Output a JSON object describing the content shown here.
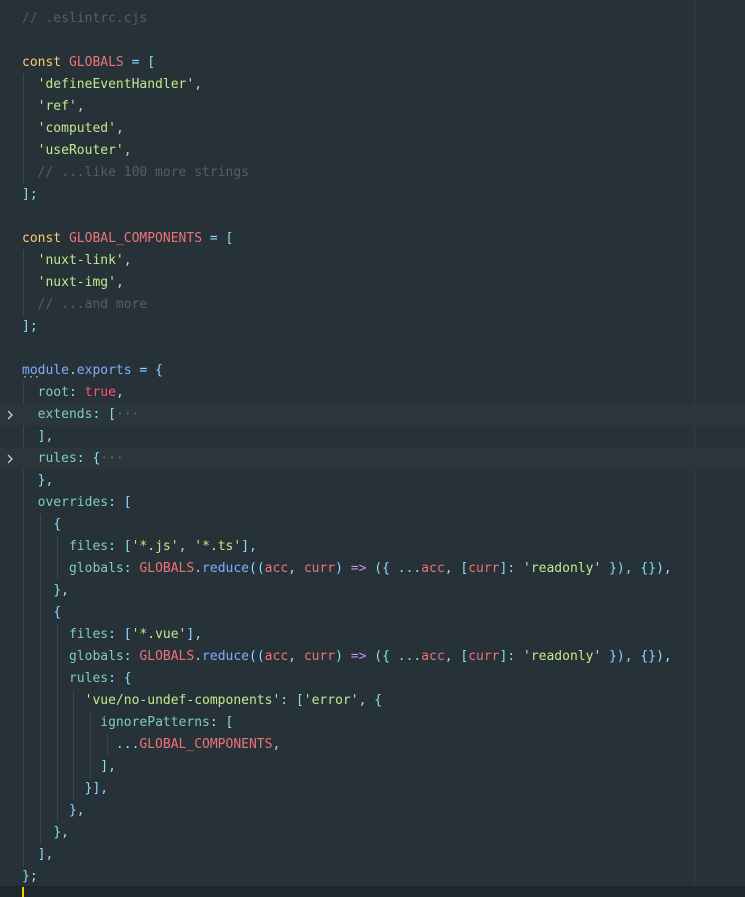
{
  "editor": {
    "file_comment": "// .eslintrc.cjs",
    "colors": {
      "background": "#263238",
      "folded_line": "#2b363b",
      "cursor": "#ffcc00"
    },
    "icons": {
      "fold_chevron": "chevron-right-icon"
    }
  },
  "lines": [
    {
      "tokens": [
        {
          "c": "comment",
          "t": "// .eslintrc.cjs"
        }
      ]
    },
    {
      "tokens": []
    },
    {
      "tokens": [
        {
          "c": "const",
          "t": "const "
        },
        {
          "c": "var",
          "t": "GLOBALS"
        },
        {
          "c": "punc",
          "t": " = ["
        }
      ]
    },
    {
      "tokens": [
        {
          "c": "plain",
          "t": "  "
        },
        {
          "c": "string",
          "t": "'defineEventHandler'"
        },
        {
          "c": "plain",
          "t": ","
        }
      ]
    },
    {
      "tokens": [
        {
          "c": "plain",
          "t": "  "
        },
        {
          "c": "string",
          "t": "'ref'"
        },
        {
          "c": "plain",
          "t": ","
        }
      ]
    },
    {
      "tokens": [
        {
          "c": "plain",
          "t": "  "
        },
        {
          "c": "string",
          "t": "'computed'"
        },
        {
          "c": "plain",
          "t": ","
        }
      ]
    },
    {
      "tokens": [
        {
          "c": "plain",
          "t": "  "
        },
        {
          "c": "string",
          "t": "'useRouter'"
        },
        {
          "c": "plain",
          "t": ","
        }
      ]
    },
    {
      "tokens": [
        {
          "c": "plain",
          "t": "  "
        },
        {
          "c": "comment",
          "t": "// ...like 100 more strings"
        }
      ]
    },
    {
      "tokens": [
        {
          "c": "punc",
          "t": "];"
        }
      ]
    },
    {
      "tokens": []
    },
    {
      "tokens": [
        {
          "c": "const",
          "t": "const "
        },
        {
          "c": "var",
          "t": "GLOBAL_COMPONENTS"
        },
        {
          "c": "punc",
          "t": " = ["
        }
      ]
    },
    {
      "tokens": [
        {
          "c": "plain",
          "t": "  "
        },
        {
          "c": "string",
          "t": "'nuxt-link'"
        },
        {
          "c": "plain",
          "t": ","
        }
      ]
    },
    {
      "tokens": [
        {
          "c": "plain",
          "t": "  "
        },
        {
          "c": "string",
          "t": "'nuxt-img'"
        },
        {
          "c": "plain",
          "t": ","
        }
      ]
    },
    {
      "tokens": [
        {
          "c": "plain",
          "t": "  "
        },
        {
          "c": "comment",
          "t": "// ...and more"
        }
      ]
    },
    {
      "tokens": [
        {
          "c": "punc",
          "t": "];"
        }
      ]
    },
    {
      "tokens": []
    },
    {
      "tokens": [
        {
          "c": "module",
          "t": "module"
        },
        {
          "c": "punc",
          "t": "."
        },
        {
          "c": "module",
          "t": "exports"
        },
        {
          "c": "punc",
          "t": " = {"
        }
      ]
    },
    {
      "tokens": [
        {
          "c": "plain",
          "t": "  "
        },
        {
          "c": "prop",
          "t": "root"
        },
        {
          "c": "punc",
          "t": ": "
        },
        {
          "c": "bool",
          "t": "true"
        },
        {
          "c": "plain",
          "t": ","
        }
      ]
    },
    {
      "folded": true,
      "tokens": [
        {
          "c": "plain",
          "t": "  "
        },
        {
          "c": "prop",
          "t": "extends"
        },
        {
          "c": "punc",
          "t": ": ["
        },
        {
          "c": "fold",
          "t": "···"
        }
      ]
    },
    {
      "tokens": [
        {
          "c": "plain",
          "t": "  "
        },
        {
          "c": "punc",
          "t": "],"
        }
      ]
    },
    {
      "folded": true,
      "tokens": [
        {
          "c": "plain",
          "t": "  "
        },
        {
          "c": "prop",
          "t": "rules"
        },
        {
          "c": "punc",
          "t": ": {"
        },
        {
          "c": "fold",
          "t": "···"
        }
      ]
    },
    {
      "tokens": [
        {
          "c": "plain",
          "t": "  "
        },
        {
          "c": "punc",
          "t": "},"
        }
      ]
    },
    {
      "tokens": [
        {
          "c": "plain",
          "t": "  "
        },
        {
          "c": "prop",
          "t": "overrides"
        },
        {
          "c": "punc",
          "t": ": ["
        }
      ]
    },
    {
      "tokens": [
        {
          "c": "plain",
          "t": "    "
        },
        {
          "c": "punc",
          "t": "{"
        }
      ]
    },
    {
      "tokens": [
        {
          "c": "plain",
          "t": "      "
        },
        {
          "c": "prop",
          "t": "files"
        },
        {
          "c": "punc",
          "t": ": ["
        },
        {
          "c": "string",
          "t": "'*.js'"
        },
        {
          "c": "plain",
          "t": ", "
        },
        {
          "c": "string",
          "t": "'*.ts'"
        },
        {
          "c": "punc",
          "t": "],"
        }
      ]
    },
    {
      "tokens": [
        {
          "c": "plain",
          "t": "      "
        },
        {
          "c": "prop",
          "t": "globals"
        },
        {
          "c": "punc",
          "t": ": "
        },
        {
          "c": "var",
          "t": "GLOBALS"
        },
        {
          "c": "punc",
          "t": "."
        },
        {
          "c": "func",
          "t": "reduce"
        },
        {
          "c": "punc",
          "t": "(("
        },
        {
          "c": "var",
          "t": "acc"
        },
        {
          "c": "plain",
          "t": ", "
        },
        {
          "c": "var",
          "t": "curr"
        },
        {
          "c": "punc",
          "t": ") "
        },
        {
          "c": "keyword",
          "t": "=>"
        },
        {
          "c": "punc",
          "t": " ({ ..."
        },
        {
          "c": "var",
          "t": "acc"
        },
        {
          "c": "plain",
          "t": ", "
        },
        {
          "c": "punc",
          "t": "["
        },
        {
          "c": "var",
          "t": "curr"
        },
        {
          "c": "punc",
          "t": "]: "
        },
        {
          "c": "string",
          "t": "'readonly'"
        },
        {
          "c": "punc",
          "t": " }), {}),"
        }
      ]
    },
    {
      "tokens": [
        {
          "c": "plain",
          "t": "    "
        },
        {
          "c": "punc",
          "t": "},"
        }
      ]
    },
    {
      "tokens": [
        {
          "c": "plain",
          "t": "    "
        },
        {
          "c": "punc",
          "t": "{"
        }
      ]
    },
    {
      "tokens": [
        {
          "c": "plain",
          "t": "      "
        },
        {
          "c": "prop",
          "t": "files"
        },
        {
          "c": "punc",
          "t": ": ["
        },
        {
          "c": "string",
          "t": "'*.vue'"
        },
        {
          "c": "punc",
          "t": "],"
        }
      ]
    },
    {
      "tokens": [
        {
          "c": "plain",
          "t": "      "
        },
        {
          "c": "prop",
          "t": "globals"
        },
        {
          "c": "punc",
          "t": ": "
        },
        {
          "c": "var",
          "t": "GLOBALS"
        },
        {
          "c": "punc",
          "t": "."
        },
        {
          "c": "func",
          "t": "reduce"
        },
        {
          "c": "punc",
          "t": "(("
        },
        {
          "c": "var",
          "t": "acc"
        },
        {
          "c": "plain",
          "t": ", "
        },
        {
          "c": "var",
          "t": "curr"
        },
        {
          "c": "punc",
          "t": ") "
        },
        {
          "c": "keyword",
          "t": "=>"
        },
        {
          "c": "punc",
          "t": " ({ ..."
        },
        {
          "c": "var",
          "t": "acc"
        },
        {
          "c": "plain",
          "t": ", "
        },
        {
          "c": "punc",
          "t": "["
        },
        {
          "c": "var",
          "t": "curr"
        },
        {
          "c": "punc",
          "t": "]: "
        },
        {
          "c": "string",
          "t": "'readonly'"
        },
        {
          "c": "punc",
          "t": " }), {}),"
        }
      ]
    },
    {
      "tokens": [
        {
          "c": "plain",
          "t": "      "
        },
        {
          "c": "prop",
          "t": "rules"
        },
        {
          "c": "punc",
          "t": ": {"
        }
      ]
    },
    {
      "tokens": [
        {
          "c": "plain",
          "t": "        "
        },
        {
          "c": "string",
          "t": "'vue/no-undef-components'"
        },
        {
          "c": "punc",
          "t": ": ["
        },
        {
          "c": "string",
          "t": "'error'"
        },
        {
          "c": "plain",
          "t": ", "
        },
        {
          "c": "punc",
          "t": "{"
        }
      ]
    },
    {
      "tokens": [
        {
          "c": "plain",
          "t": "          "
        },
        {
          "c": "prop",
          "t": "ignorePatterns"
        },
        {
          "c": "punc",
          "t": ": ["
        }
      ]
    },
    {
      "tokens": [
        {
          "c": "plain",
          "t": "            "
        },
        {
          "c": "punc",
          "t": "..."
        },
        {
          "c": "var",
          "t": "GLOBAL_COMPONENTS"
        },
        {
          "c": "plain",
          "t": ","
        }
      ]
    },
    {
      "tokens": [
        {
          "c": "plain",
          "t": "          "
        },
        {
          "c": "punc",
          "t": "],"
        }
      ]
    },
    {
      "tokens": [
        {
          "c": "plain",
          "t": "        "
        },
        {
          "c": "punc",
          "t": "}],"
        }
      ]
    },
    {
      "tokens": [
        {
          "c": "plain",
          "t": "      "
        },
        {
          "c": "punc",
          "t": "},"
        }
      ]
    },
    {
      "tokens": [
        {
          "c": "plain",
          "t": "    "
        },
        {
          "c": "punc",
          "t": "},"
        }
      ]
    },
    {
      "tokens": [
        {
          "c": "plain",
          "t": "  "
        },
        {
          "c": "punc",
          "t": "],"
        }
      ]
    },
    {
      "tokens": [
        {
          "c": "punc",
          "t": "};"
        }
      ]
    }
  ]
}
